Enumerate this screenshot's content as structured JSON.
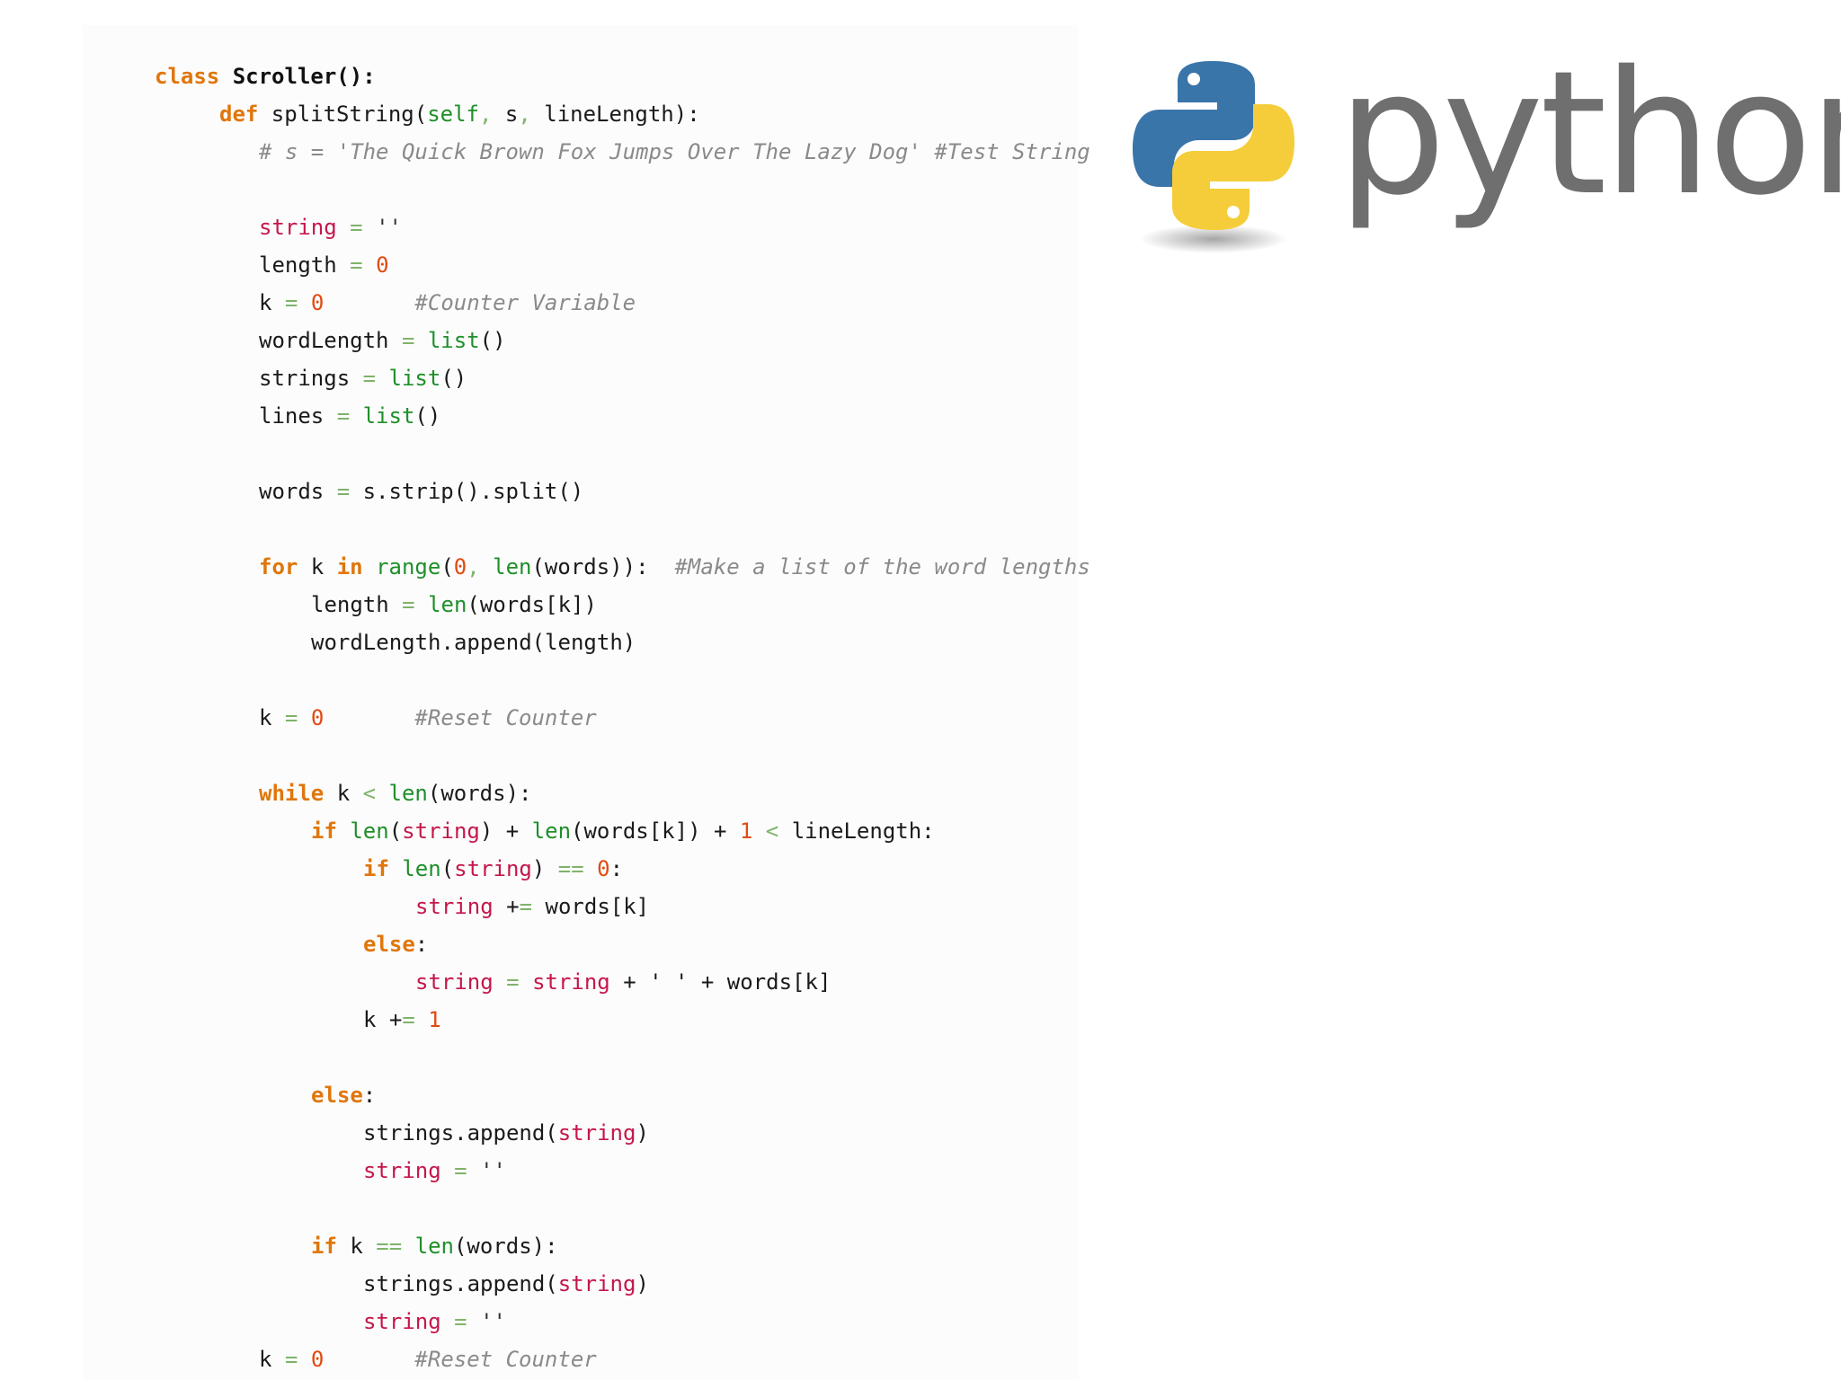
{
  "logo": {
    "wordmark": "python",
    "colors": {
      "blue": "#3a75a9",
      "yellow": "#f5cd3a",
      "wordmark": "#6f6f6f"
    },
    "icon": "python-logo-icon"
  },
  "code": {
    "lines": [
      [
        {
          "t": "class ",
          "c": "kw"
        },
        {
          "t": "Scroller():",
          "c": "cls"
        }
      ],
      [
        {
          "t": "def ",
          "c": "kw"
        },
        {
          "t": "splitString(",
          "c": ""
        },
        {
          "t": "self",
          "c": "bi"
        },
        {
          "t": ", ",
          "c": "op"
        },
        {
          "t": "s",
          "c": ""
        },
        {
          "t": ", ",
          "c": "op"
        },
        {
          "t": "lineLength):",
          "c": ""
        }
      ],
      [
        {
          "t": "# s = 'The Quick Brown Fox Jumps Over The Lazy Dog' #Test String",
          "c": "cm"
        }
      ],
      [],
      [
        {
          "t": "string",
          "c": "var"
        },
        {
          "t": " = ",
          "c": "op"
        },
        {
          "t": "''",
          "c": "str"
        }
      ],
      [
        {
          "t": "length",
          "c": ""
        },
        {
          "t": " = ",
          "c": "op"
        },
        {
          "t": "0",
          "c": "num"
        }
      ],
      [
        {
          "t": "k",
          "c": ""
        },
        {
          "t": " = ",
          "c": "op"
        },
        {
          "t": "0",
          "c": "num"
        },
        {
          "t": "       ",
          "c": ""
        },
        {
          "t": "#Counter Variable",
          "c": "cm"
        }
      ],
      [
        {
          "t": "wordLength",
          "c": ""
        },
        {
          "t": " = ",
          "c": "op"
        },
        {
          "t": "list",
          "c": "bi"
        },
        {
          "t": "()",
          "c": ""
        }
      ],
      [
        {
          "t": "strings",
          "c": ""
        },
        {
          "t": " = ",
          "c": "op"
        },
        {
          "t": "list",
          "c": "bi"
        },
        {
          "t": "()",
          "c": ""
        }
      ],
      [
        {
          "t": "lines",
          "c": ""
        },
        {
          "t": " = ",
          "c": "op"
        },
        {
          "t": "list",
          "c": "bi"
        },
        {
          "t": "()",
          "c": ""
        }
      ],
      [],
      [
        {
          "t": "words",
          "c": ""
        },
        {
          "t": " = ",
          "c": "op"
        },
        {
          "t": "s.strip().split()",
          "c": ""
        }
      ],
      [],
      [
        {
          "t": "for ",
          "c": "kw"
        },
        {
          "t": "k ",
          "c": ""
        },
        {
          "t": "in ",
          "c": "kw"
        },
        {
          "t": "range",
          "c": "bi"
        },
        {
          "t": "(",
          "c": ""
        },
        {
          "t": "0",
          "c": "num"
        },
        {
          "t": ", ",
          "c": "op"
        },
        {
          "t": "len",
          "c": "bi"
        },
        {
          "t": "(words)):  ",
          "c": ""
        },
        {
          "t": "#Make a list of the word lengths",
          "c": "cm"
        }
      ],
      [
        {
          "t": "length",
          "c": ""
        },
        {
          "t": " = ",
          "c": "op"
        },
        {
          "t": "len",
          "c": "bi"
        },
        {
          "t": "(words[k])",
          "c": ""
        }
      ],
      [
        {
          "t": "wordLength.append(length)",
          "c": ""
        }
      ],
      [],
      [
        {
          "t": "k",
          "c": ""
        },
        {
          "t": " = ",
          "c": "op"
        },
        {
          "t": "0",
          "c": "num"
        },
        {
          "t": "       ",
          "c": ""
        },
        {
          "t": "#Reset Counter",
          "c": "cm"
        }
      ],
      [],
      [
        {
          "t": "while ",
          "c": "kw"
        },
        {
          "t": "k ",
          "c": ""
        },
        {
          "t": "< ",
          "c": "op"
        },
        {
          "t": "len",
          "c": "bi"
        },
        {
          "t": "(words):",
          "c": ""
        }
      ],
      [
        {
          "t": "if ",
          "c": "kw"
        },
        {
          "t": "len",
          "c": "bi"
        },
        {
          "t": "(",
          "c": ""
        },
        {
          "t": "string",
          "c": "var"
        },
        {
          "t": ") + ",
          "c": ""
        },
        {
          "t": "len",
          "c": "bi"
        },
        {
          "t": "(words[k]) + ",
          "c": ""
        },
        {
          "t": "1",
          "c": "num"
        },
        {
          "t": " < ",
          "c": "op"
        },
        {
          "t": "lineLength:",
          "c": ""
        }
      ],
      [
        {
          "t": "if ",
          "c": "kw"
        },
        {
          "t": "len",
          "c": "bi"
        },
        {
          "t": "(",
          "c": ""
        },
        {
          "t": "string",
          "c": "var"
        },
        {
          "t": ") ",
          "c": ""
        },
        {
          "t": "== ",
          "c": "op"
        },
        {
          "t": "0",
          "c": "num"
        },
        {
          "t": ":",
          "c": ""
        }
      ],
      [
        {
          "t": "string",
          "c": "var"
        },
        {
          "t": " +",
          "c": ""
        },
        {
          "t": "= ",
          "c": "op"
        },
        {
          "t": "words[k]",
          "c": ""
        }
      ],
      [
        {
          "t": "else",
          "c": "kw"
        },
        {
          "t": ":",
          "c": ""
        }
      ],
      [
        {
          "t": "string",
          "c": "var"
        },
        {
          "t": " = ",
          "c": "op"
        },
        {
          "t": "string",
          "c": "var"
        },
        {
          "t": " + ' ' + words[k]",
          "c": ""
        }
      ],
      [
        {
          "t": "k +",
          "c": ""
        },
        {
          "t": "= ",
          "c": "op"
        },
        {
          "t": "1",
          "c": "num"
        }
      ],
      [],
      [
        {
          "t": "else",
          "c": "kw"
        },
        {
          "t": ":",
          "c": ""
        }
      ],
      [
        {
          "t": "strings.append(",
          "c": ""
        },
        {
          "t": "string",
          "c": "var"
        },
        {
          "t": ")",
          "c": ""
        }
      ],
      [
        {
          "t": "string",
          "c": "var"
        },
        {
          "t": " = ",
          "c": "op"
        },
        {
          "t": "''",
          "c": "str"
        }
      ],
      [],
      [
        {
          "t": "if ",
          "c": "kw"
        },
        {
          "t": "k ",
          "c": ""
        },
        {
          "t": "== ",
          "c": "op"
        },
        {
          "t": "len",
          "c": "bi"
        },
        {
          "t": "(words):",
          "c": ""
        }
      ],
      [
        {
          "t": "strings.append(",
          "c": ""
        },
        {
          "t": "string",
          "c": "var"
        },
        {
          "t": ")",
          "c": ""
        }
      ],
      [
        {
          "t": "string",
          "c": "var"
        },
        {
          "t": " = ",
          "c": "op"
        },
        {
          "t": "''",
          "c": "str"
        }
      ],
      [
        {
          "t": "k",
          "c": ""
        },
        {
          "t": " = ",
          "c": "op"
        },
        {
          "t": "0",
          "c": "num"
        },
        {
          "t": "       ",
          "c": ""
        },
        {
          "t": "#Reset Counter",
          "c": "cm"
        }
      ]
    ]
  }
}
